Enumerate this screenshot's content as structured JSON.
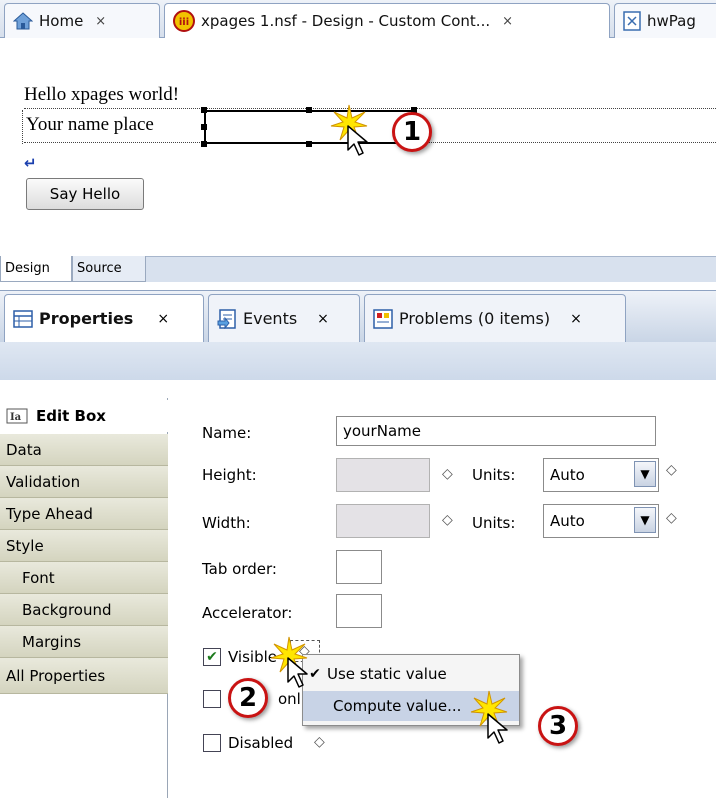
{
  "editor_tabs": [
    {
      "label": "Home",
      "icon": "home-icon"
    },
    {
      "label": "xpages 1.nsf - Design - Custom Cont...",
      "icon": "nsf-database-icon"
    },
    {
      "label": "hwPag",
      "icon": "xpage-icon"
    }
  ],
  "close_glyph": "×",
  "canvas": {
    "line1": "Hello xpages world!",
    "line2_label": "Your name place",
    "return_mark": "↵",
    "button_label": "Say Hello"
  },
  "design_tabs": {
    "design": "Design",
    "source": "Source"
  },
  "view_tabs": [
    {
      "label": "Properties",
      "icon": "properties-icon"
    },
    {
      "label": "Events",
      "icon": "events-icon"
    },
    {
      "label": "Problems (0 items)",
      "icon": "problems-icon"
    }
  ],
  "sidebar": {
    "title": "Edit Box",
    "title_icon": "edit-box-icon",
    "items": [
      "Data",
      "Validation",
      "Type Ahead",
      "Style",
      "Font",
      "Background",
      "Margins",
      "All Properties"
    ]
  },
  "form": {
    "name_label": "Name:",
    "name_value": "yourName",
    "height_label": "Height:",
    "width_label": "Width:",
    "units_label": "Units:",
    "units_height": "Auto",
    "units_width": "Auto",
    "tab_order_label": "Tab order:",
    "accelerator_label": "Accelerator:",
    "visible_label": "Visible",
    "visible_checked": true,
    "readonly_label_partial": "onl",
    "disabled_label": "Disabled",
    "diamond": "◇"
  },
  "context_menu": {
    "items": [
      {
        "label": "Use static value",
        "checked": true
      },
      {
        "label": "Compute value...",
        "checked": false
      }
    ]
  },
  "callouts": [
    "1",
    "2",
    "3"
  ],
  "colors": {
    "callout_ring": "#c91313",
    "check_green": "#1c7a1c",
    "menu_highlight": "#c8d3e6"
  }
}
